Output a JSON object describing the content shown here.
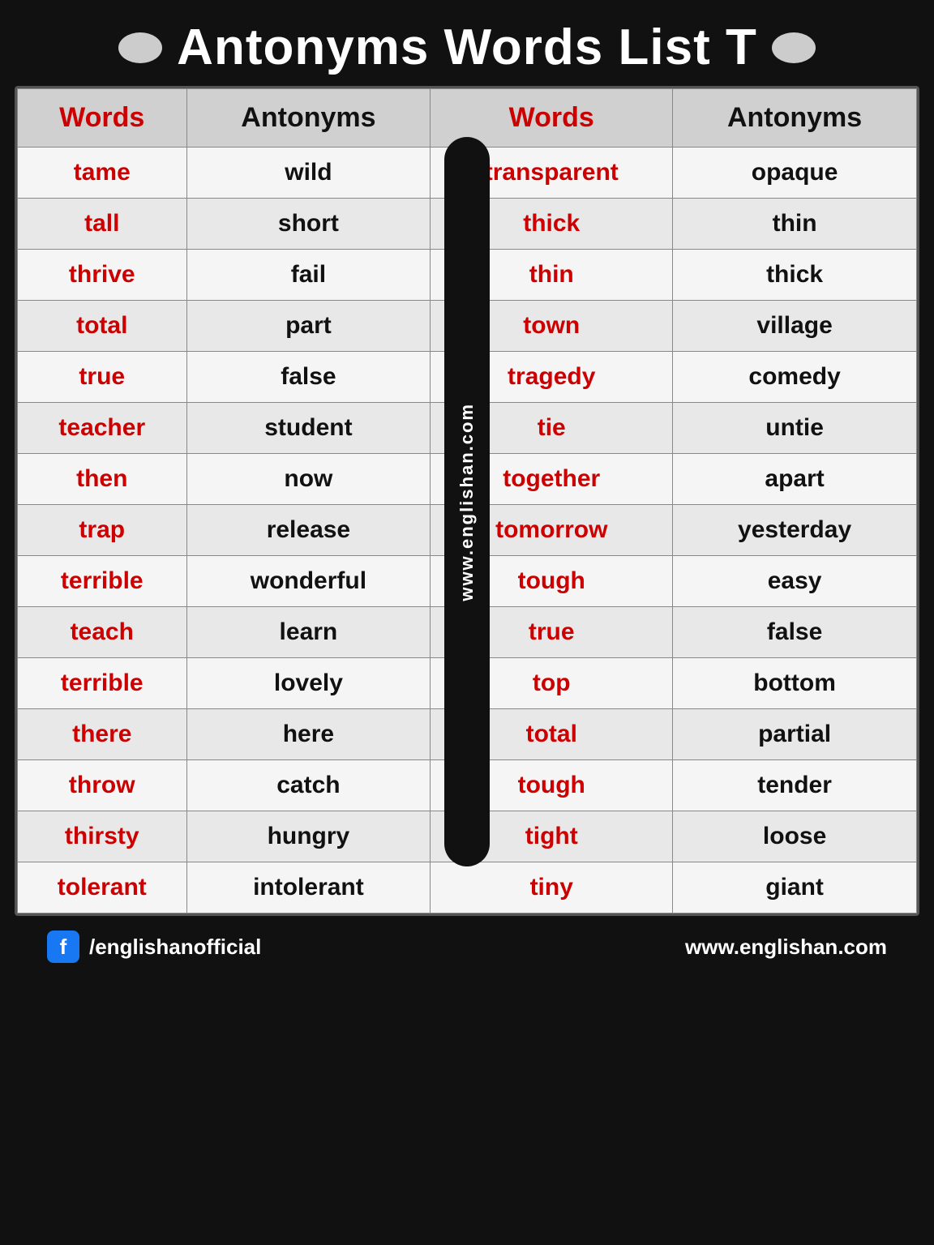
{
  "title": "Antonyms Words  List T",
  "columns": {
    "col1": "Words",
    "col2": "Antonyms",
    "col3": "Words",
    "col4": "Antonyms"
  },
  "rows": [
    {
      "w1": "tame",
      "a1": "wild",
      "w2": "transparent",
      "a2": "opaque"
    },
    {
      "w1": "tall",
      "a1": "short",
      "w2": "thick",
      "a2": "thin"
    },
    {
      "w1": "thrive",
      "a1": "fail",
      "w2": "thin",
      "a2": "thick"
    },
    {
      "w1": "total",
      "a1": "part",
      "w2": "town",
      "a2": "village"
    },
    {
      "w1": "true",
      "a1": "false",
      "w2": "tragedy",
      "a2": "comedy"
    },
    {
      "w1": "teacher",
      "a1": "student",
      "w2": "tie",
      "a2": "untie"
    },
    {
      "w1": "then",
      "a1": "now",
      "w2": "together",
      "a2": "apart"
    },
    {
      "w1": "trap",
      "a1": "release",
      "w2": "tomorrow",
      "a2": "yesterday"
    },
    {
      "w1": "terrible",
      "a1": "wonderful",
      "w2": "tough",
      "a2": "easy"
    },
    {
      "w1": "teach",
      "a1": "learn",
      "w2": "true",
      "a2": "false"
    },
    {
      "w1": "terrible",
      "a1": "lovely",
      "w2": "top",
      "a2": "bottom"
    },
    {
      "w1": "there",
      "a1": "here",
      "w2": "total",
      "a2": "partial"
    },
    {
      "w1": "throw",
      "a1": "catch",
      "w2": "tough",
      "a2": "tender"
    },
    {
      "w1": "thirsty",
      "a1": "hungry",
      "w2": "tight",
      "a2": "loose"
    },
    {
      "w1": "tolerant",
      "a1": "intolerant",
      "w2": "tiny",
      "a2": "giant"
    }
  ],
  "watermark": "www.englishan.com",
  "footer": {
    "fb_handle": "/englishanofficial",
    "website": "www.englishan.com"
  }
}
